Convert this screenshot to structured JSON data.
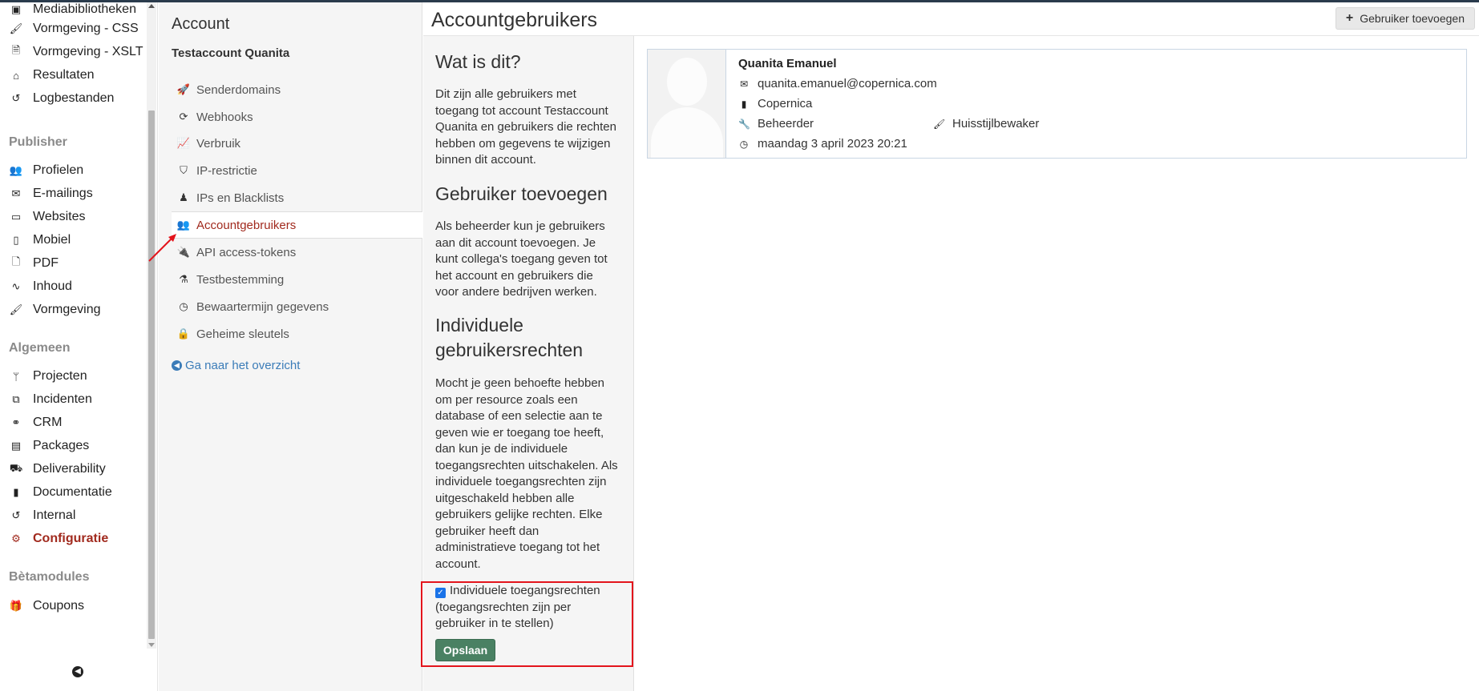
{
  "sidebar": {
    "items_top": [
      {
        "label": "Mediabibliotheken",
        "icon": "image-icon"
      },
      {
        "label": "Vormgeving - CSS",
        "icon": "brush-icon"
      },
      {
        "label": "Vormgeving - XSLT",
        "icon": "file-code-icon"
      },
      {
        "label": "Resultaten",
        "icon": "inbox-icon"
      },
      {
        "label": "Logbestanden",
        "icon": "history-icon"
      }
    ],
    "publisher_heading": "Publisher",
    "publisher_items": [
      {
        "label": "Profielen",
        "icon": "users-icon"
      },
      {
        "label": "E-mailings",
        "icon": "envelope-icon"
      },
      {
        "label": "Websites",
        "icon": "desktop-icon"
      },
      {
        "label": "Mobiel",
        "icon": "mobile-icon"
      },
      {
        "label": "PDF",
        "icon": "file-pdf-icon"
      },
      {
        "label": "Inhoud",
        "icon": "rss-icon"
      },
      {
        "label": "Vormgeving",
        "icon": "brush-icon"
      }
    ],
    "algemeen_heading": "Algemeen",
    "algemeen_items": [
      {
        "label": "Projecten",
        "icon": "branch-icon"
      },
      {
        "label": "Incidenten",
        "icon": "cubes-icon"
      },
      {
        "label": "CRM",
        "icon": "handshake-icon"
      },
      {
        "label": "Packages",
        "icon": "id-card-icon"
      },
      {
        "label": "Deliverability",
        "icon": "truck-icon"
      },
      {
        "label": "Documentatie",
        "icon": "file-icon"
      },
      {
        "label": "Internal",
        "icon": "history-icon"
      },
      {
        "label": "Configuratie",
        "icon": "cogs-icon"
      }
    ],
    "beta_heading": "Bètamodules",
    "beta_items": [
      {
        "label": "Coupons",
        "icon": "gift-icon"
      }
    ]
  },
  "submenu": {
    "title": "Account",
    "account_name": "Testaccount Quanita",
    "items": [
      {
        "label": "Senderdomains",
        "icon": "rocket-icon"
      },
      {
        "label": "Webhooks",
        "icon": "refresh-icon"
      },
      {
        "label": "Verbruik",
        "icon": "line-chart-icon"
      },
      {
        "label": "IP-restrictie",
        "icon": "shield-icon"
      },
      {
        "label": "IPs en Blacklists",
        "icon": "user-secret-icon"
      },
      {
        "label": "Accountgebruikers",
        "icon": "users-icon"
      },
      {
        "label": "API access-tokens",
        "icon": "plug-icon"
      },
      {
        "label": "Testbestemming",
        "icon": "flask-icon"
      },
      {
        "label": "Bewaartermijn gegevens",
        "icon": "clock-icon"
      },
      {
        "label": "Geheime sleutels",
        "icon": "lock-icon"
      }
    ],
    "back_link": "Ga naar het overzicht"
  },
  "header": {
    "title": "Accountgebruikers",
    "add_button": "Gebruiker toevoegen"
  },
  "info": {
    "h_what": "Wat is dit?",
    "p_what": "Dit zijn alle gebruikers met toegang tot account Testaccount Quanita en gebruikers die rechten hebben om gegevens te wijzigen binnen dit account.",
    "h_add": "Gebruiker toevoegen",
    "p_add": "Als beheerder kun je gebruikers aan dit account toevoegen. Je kunt collega's toegang geven tot het account en gebruikers die voor andere bedrijven werken.",
    "h_rights": "Individuele gebruikersrechten",
    "p_rights": "Mocht je geen behoefte hebben om per resource zoals een database of een selectie aan te geven wie er toegang toe heeft, dan kun je de individuele toegangsrechten uitschakelen. Als individuele toegangsrechten zijn uitgeschakeld hebben alle gebruikers gelijke rechten. Elke gebruiker heeft dan administratieve toegang tot het account.",
    "checkbox_label": "Individuele toegangsrechten (toegangsrechten zijn per gebruiker in te stellen)",
    "checkbox_checked": true,
    "save_label": "Opslaan"
  },
  "user": {
    "name": "Quanita Emanuel",
    "email": "quanita.emanuel@copernica.com",
    "company": "Copernica",
    "role1": "Beheerder",
    "role2": "Huisstijlbewaker",
    "last_login": "maandag 3 april 2023 20:21"
  },
  "colors": {
    "accent": "#a12a1e",
    "link": "#3b7cb8",
    "save_button": "#4a8163",
    "highlight_box": "#e3141c"
  }
}
